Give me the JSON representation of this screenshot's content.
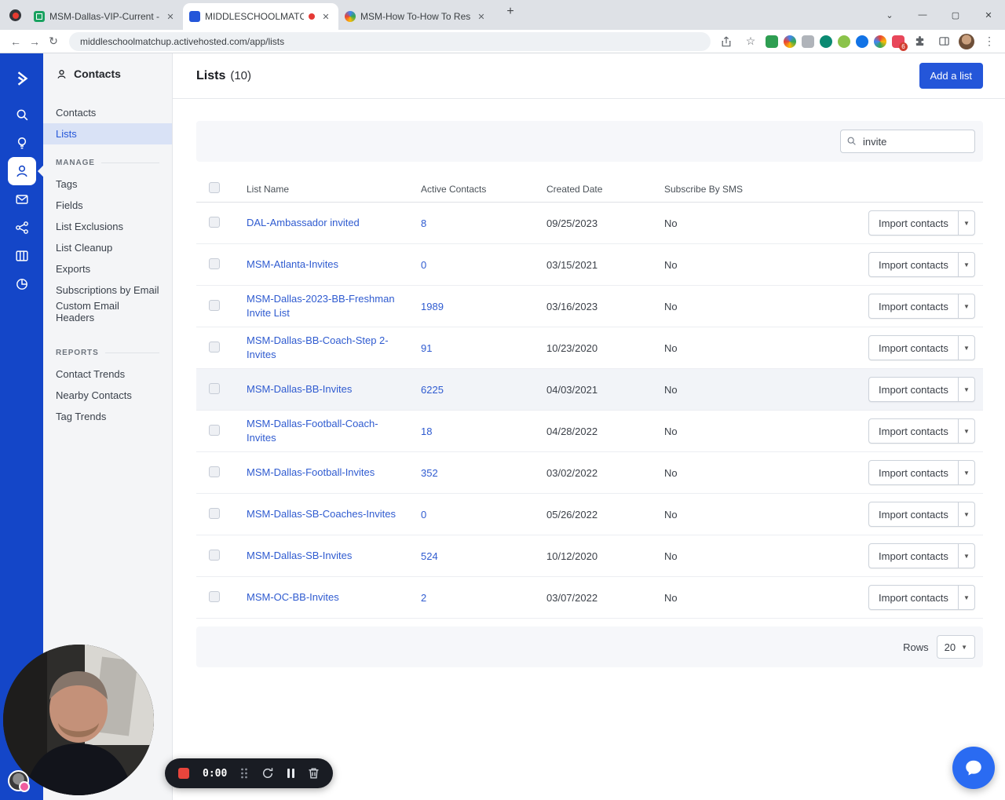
{
  "browser": {
    "tabs": [
      {
        "title": "MSM-Dallas-VIP-Current - Goog...",
        "active": false
      },
      {
        "title": "MIDDLESCHOOLMATCHUP",
        "active": true,
        "recording": true
      },
      {
        "title": "MSM-How To-How To Reset yo...",
        "active": false
      }
    ],
    "url": "middleschoolmatchup.activehosted.com/app/lists",
    "extension_badge": "6",
    "window_controls": {
      "minimize": "—",
      "maximize": "▢",
      "close": "✕"
    }
  },
  "subnav": {
    "title": "Contacts",
    "items": [
      {
        "label": "Contacts",
        "active": false
      },
      {
        "label": "Lists",
        "active": true
      }
    ],
    "sections": [
      {
        "label": "MANAGE",
        "items": [
          "Tags",
          "Fields",
          "List Exclusions",
          "List Cleanup",
          "Exports",
          "Subscriptions by Email",
          "Custom Email Headers"
        ]
      },
      {
        "label": "REPORTS",
        "items": [
          "Contact Trends",
          "Nearby Contacts",
          "Tag Trends"
        ]
      }
    ]
  },
  "main": {
    "title": "Lists",
    "count": "(10)",
    "add_button": "Add a list",
    "search_value": "invite",
    "table": {
      "columns": [
        "List Name",
        "Active Contacts",
        "Created Date",
        "Subscribe By SMS"
      ],
      "action_label": "Import contacts",
      "rows": [
        {
          "name": "DAL-Ambassador invited",
          "active_contacts": "8",
          "created": "09/25/2023",
          "sms": "No",
          "highlighted": false
        },
        {
          "name": "MSM-Atlanta-Invites",
          "active_contacts": "0",
          "created": "03/15/2021",
          "sms": "No",
          "highlighted": false
        },
        {
          "name": "MSM-Dallas-2023-BB-Freshman Invite List",
          "active_contacts": "1989",
          "created": "03/16/2023",
          "sms": "No",
          "highlighted": false
        },
        {
          "name": "MSM-Dallas-BB-Coach-Step 2-Invites",
          "active_contacts": "91",
          "created": "10/23/2020",
          "sms": "No",
          "highlighted": false
        },
        {
          "name": "MSM-Dallas-BB-Invites",
          "active_contacts": "6225",
          "created": "04/03/2021",
          "sms": "No",
          "highlighted": true
        },
        {
          "name": "MSM-Dallas-Football-Coach-Invites",
          "active_contacts": "18",
          "created": "04/28/2022",
          "sms": "No",
          "highlighted": false
        },
        {
          "name": "MSM-Dallas-Football-Invites",
          "active_contacts": "352",
          "created": "03/02/2022",
          "sms": "No",
          "highlighted": false
        },
        {
          "name": "MSM-Dallas-SB-Coaches-Invites",
          "active_contacts": "0",
          "created": "05/26/2022",
          "sms": "No",
          "highlighted": false
        },
        {
          "name": "MSM-Dallas-SB-Invites",
          "active_contacts": "524",
          "created": "10/12/2020",
          "sms": "No",
          "highlighted": false
        },
        {
          "name": "MSM-OC-BB-Invites",
          "active_contacts": "2",
          "created": "03/07/2022",
          "sms": "No",
          "highlighted": false
        }
      ]
    },
    "pagination": {
      "rows_label": "Rows",
      "rows_value": "20"
    }
  },
  "recorder": {
    "time": "0:00"
  },
  "colors": {
    "accent": "#1446c8",
    "link": "#2f5bd0",
    "button": "#2456d9"
  }
}
